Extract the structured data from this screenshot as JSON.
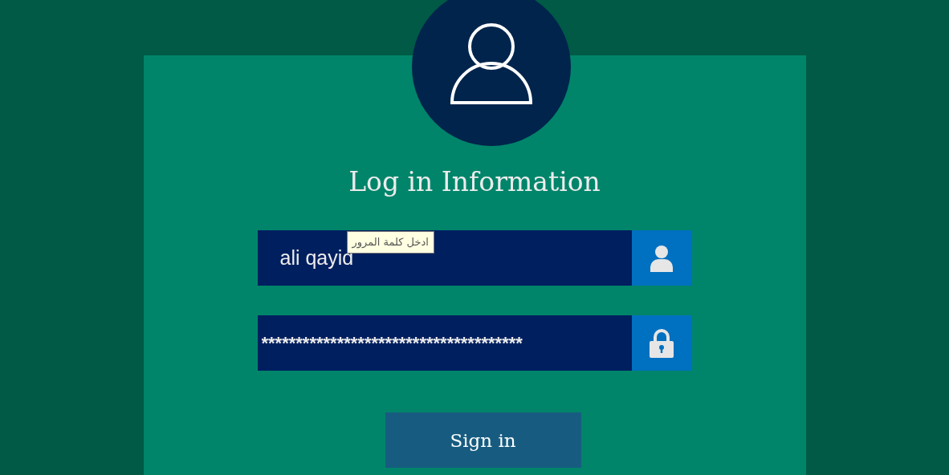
{
  "title": "Log in Information",
  "fields": [
    {
      "kind": "username",
      "value": "ali qayid"
    },
    {
      "kind": "password",
      "value": "**************************************"
    }
  ],
  "tooltip": "ادخل كلمة المرور",
  "sign_in_button": "Sign in"
}
